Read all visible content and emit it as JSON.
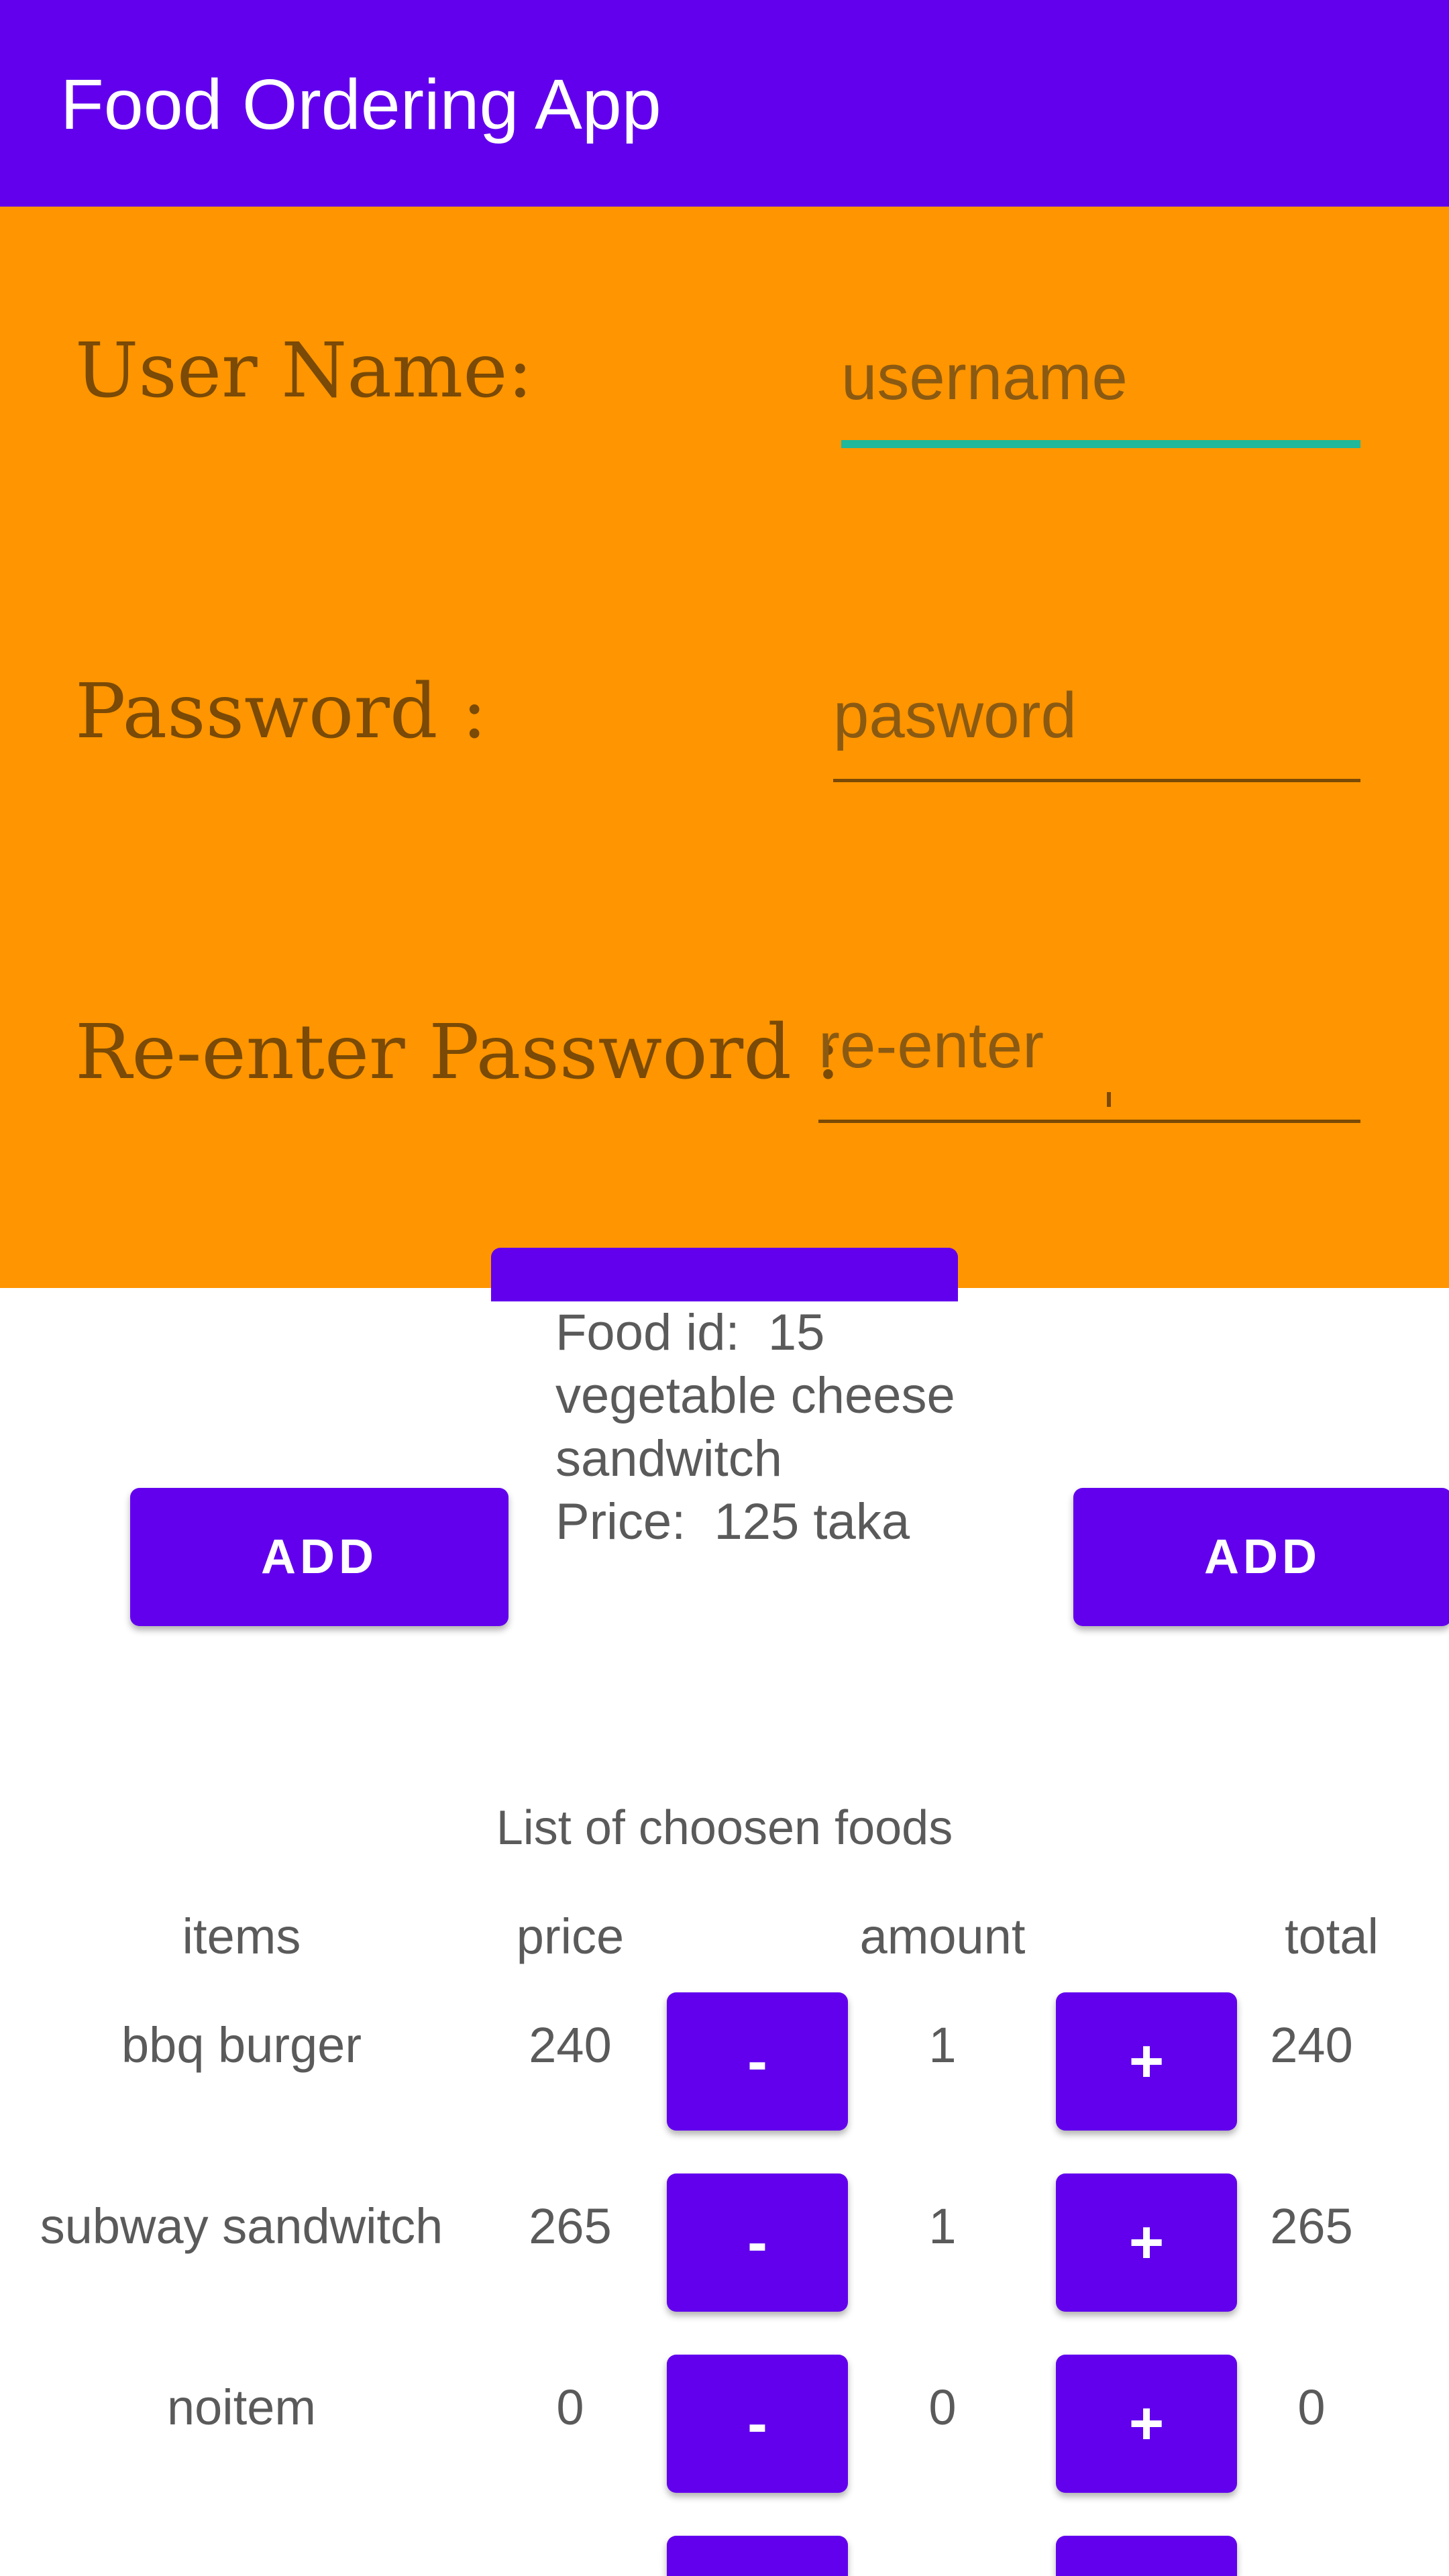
{
  "app": {
    "title": "Food Ordering App"
  },
  "form": {
    "username_label": "User Name:",
    "username_placeholder": "username",
    "password_label": "Password :",
    "password_placeholder": "pasword",
    "reenter_label": "Re-enter Password :",
    "reenter_placeholder": "re-enter"
  },
  "food": {
    "id_label": "Food id:",
    "id_value": "15",
    "name_line1": "vegetable cheese",
    "name_line2": "sandwitch",
    "price_label": "Price:",
    "price_value": "125 taka"
  },
  "buttons": {
    "add_left": "ADD",
    "add_right": "ADD"
  },
  "list": {
    "title": "List of choosen foods",
    "headers": {
      "items": "items",
      "price": "price",
      "amount": "amount",
      "total": "total"
    },
    "rows": [
      {
        "item": "bbq burger",
        "price": "240",
        "minus": "-",
        "amount": "1",
        "plus": "+",
        "total": "240"
      },
      {
        "item": "subway sandwitch",
        "price": "265",
        "minus": "-",
        "amount": "1",
        "plus": "+",
        "total": "265"
      },
      {
        "item": "noitem",
        "price": "0",
        "minus": "-",
        "amount": "0",
        "plus": "+",
        "total": "0"
      }
    ]
  },
  "colors": {
    "primary": "#6200EE",
    "panel": "#FF9500",
    "focus_underline": "#1FB89A"
  }
}
